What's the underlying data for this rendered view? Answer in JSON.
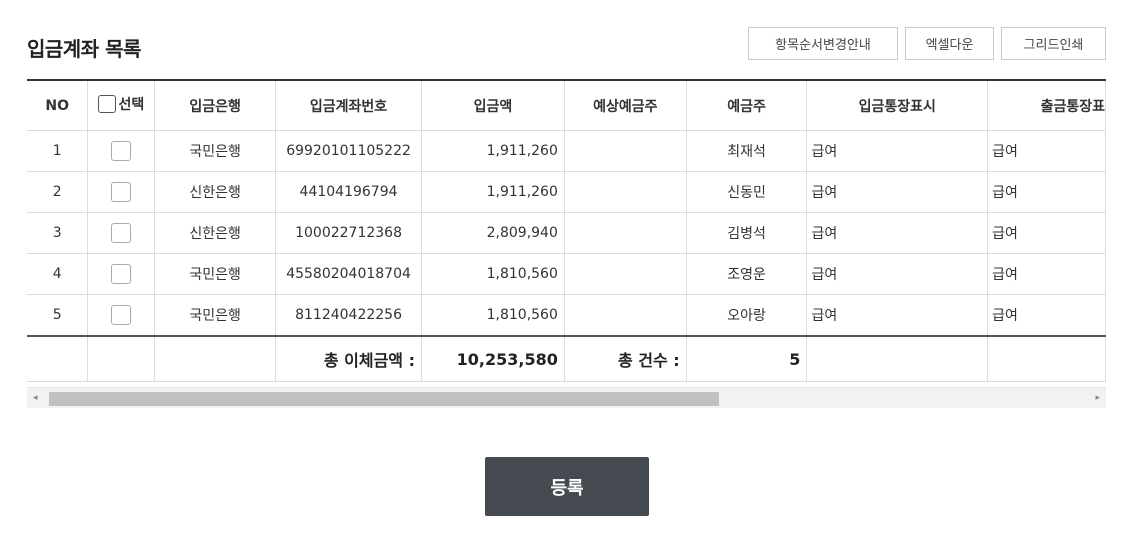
{
  "page": {
    "title": "입금계좌 목록",
    "toolbar": {
      "order_guide": "항목순서변경안내",
      "excel_download": "엑셀다운",
      "grid_print": "그리드인쇄"
    },
    "register_label": "등록"
  },
  "grid": {
    "headers": {
      "no": "NO",
      "select": "선택",
      "bank": "입금은행",
      "account": "입금계좌번호",
      "amount": "입금액",
      "expected_holder": "예상예금주",
      "holder": "예금주",
      "deposit_memo": "입금통장표시",
      "withdraw_memo": "출금통장표"
    },
    "rows": [
      {
        "no": "1",
        "bank": "국민은행",
        "account": "69920101105222",
        "amount": "1,911,260",
        "expected_holder": "",
        "holder": "최재석",
        "deposit_memo": "급여",
        "withdraw_memo": "급여"
      },
      {
        "no": "2",
        "bank": "신한은행",
        "account": "44104196794",
        "amount": "1,911,260",
        "expected_holder": "",
        "holder": "신동민",
        "deposit_memo": "급여",
        "withdraw_memo": "급여"
      },
      {
        "no": "3",
        "bank": "신한은행",
        "account": "100022712368",
        "amount": "2,809,940",
        "expected_holder": "",
        "holder": "김병석",
        "deposit_memo": "급여",
        "withdraw_memo": "급여"
      },
      {
        "no": "4",
        "bank": "국민은행",
        "account": "45580204018704",
        "amount": "1,810,560",
        "expected_holder": "",
        "holder": "조영운",
        "deposit_memo": "급여",
        "withdraw_memo": "급여"
      },
      {
        "no": "5",
        "bank": "국민은행",
        "account": "811240422256",
        "amount": "1,810,560",
        "expected_holder": "",
        "holder": "오아랑",
        "deposit_memo": "급여",
        "withdraw_memo": "급여"
      }
    ],
    "summary": {
      "total_label": "총 이체금액 :",
      "total_value": "10,253,580",
      "count_label": "총 건수 :",
      "count_value": "5"
    }
  },
  "scrollbar": {
    "left_arrow_icon": "◂",
    "right_arrow_icon": "▸"
  },
  "colors": {
    "register_button": "#444a4f",
    "header_rule": "#333333"
  }
}
